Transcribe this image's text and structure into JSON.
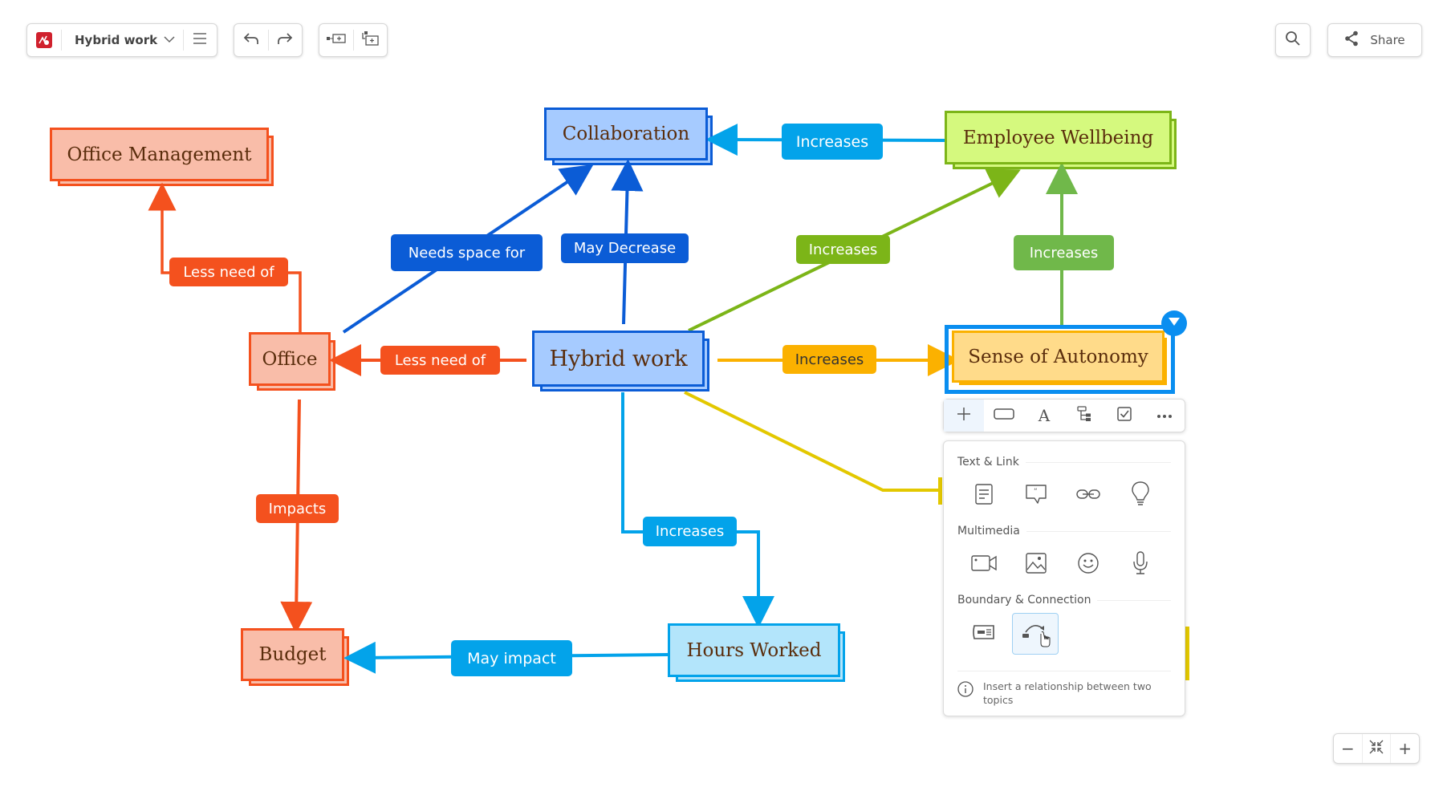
{
  "app": {
    "document_title": "Hybrid work",
    "share_label": "Share"
  },
  "colors": {
    "orange": "#f4511e",
    "blue_dark": "#0b5cd6",
    "blue_light": "#03a3ea",
    "green": "#7cb518",
    "green_light": "#70b84a",
    "yellow_orange": "#fbb100",
    "yellow": "#e3c800",
    "selection": "#0a8ef0"
  },
  "topics": [
    {
      "id": "office_management",
      "text": "Office Management"
    },
    {
      "id": "collaboration",
      "text": "Collaboration"
    },
    {
      "id": "employee_wellbeing",
      "text": "Employee Wellbeing"
    },
    {
      "id": "office",
      "text": "Office"
    },
    {
      "id": "hybrid_work",
      "text": "Hybrid work"
    },
    {
      "id": "sense_of_autonomy",
      "text": "Sense of Autonomy"
    },
    {
      "id": "budget",
      "text": "Budget"
    },
    {
      "id": "hours_worked",
      "text": "Hours Worked"
    }
  ],
  "relationships": [
    {
      "id": "r1",
      "label": "Less need of",
      "from": "Office",
      "to": "Office Management"
    },
    {
      "id": "r2",
      "label": "Needs space for",
      "from": "Office",
      "to": "Collaboration"
    },
    {
      "id": "r3",
      "label": "May Decrease",
      "from": "Hybrid work",
      "to": "Collaboration"
    },
    {
      "id": "r4",
      "label": "Increases",
      "from": "Employee Wellbeing",
      "to": "Collaboration"
    },
    {
      "id": "r5",
      "label": "Increases",
      "from": "Hybrid work",
      "to": "Employee Wellbeing"
    },
    {
      "id": "r6",
      "label": "Increases",
      "from": "Sense of Autonomy",
      "to": "Employee Wellbeing"
    },
    {
      "id": "r7",
      "label": "Less need of",
      "from": "Hybrid work",
      "to": "Office"
    },
    {
      "id": "r8",
      "label": "Increases",
      "from": "Hybrid work",
      "to": "Sense of Autonomy"
    },
    {
      "id": "r9",
      "label": "Impacts",
      "from": "Office",
      "to": "Budget"
    },
    {
      "id": "r10",
      "label": "Increases",
      "from": "Hybrid work",
      "to": "Hours Worked"
    },
    {
      "id": "r11",
      "label": "May impact",
      "from": "Hours Worked",
      "to": "Budget"
    }
  ],
  "context_toolbar": {
    "items": [
      "add-icon",
      "shape-icon",
      "text-style-icon",
      "structure-icon",
      "task-icon",
      "more-icon"
    ]
  },
  "insert_panel": {
    "sections": [
      {
        "title": "Text & Link",
        "items": [
          "note-icon",
          "comment-icon",
          "link-icon",
          "idea-icon"
        ]
      },
      {
        "title": "Multimedia",
        "items": [
          "video-icon",
          "image-icon",
          "emoji-icon",
          "audio-icon"
        ]
      },
      {
        "title": "Boundary & Connection",
        "items": [
          "boundary-icon",
          "relationship-icon"
        ]
      }
    ],
    "hint": "Insert a relationship between two topics"
  },
  "zoom_controls": {
    "minus": "−",
    "plus": "+"
  }
}
